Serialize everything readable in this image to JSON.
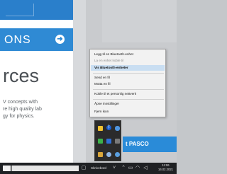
{
  "web_page": {
    "section_title": "ONS",
    "arrow_icon": "arrow-right-icon",
    "heading": "rces",
    "body_lines": [
      "V concepts with",
      "re high quality lab",
      "gy for physics."
    ]
  },
  "context_menu": {
    "items": [
      {
        "label": "Legg til en Bluetooth-enhet",
        "state": "normal"
      },
      {
        "label": "La en enhet koble til",
        "state": "disabled"
      },
      {
        "label": "Vis Bluetooth-enheter",
        "state": "highlighted"
      },
      {
        "label": "Send en fil",
        "state": "normal"
      },
      {
        "label": "Motta en fil",
        "state": "normal"
      },
      {
        "label": "Koble til et personlig nettverk",
        "state": "normal"
      },
      {
        "label": "Åpne innstillinger",
        "state": "normal"
      },
      {
        "label": "Fjern ikon",
        "state": "normal"
      }
    ]
  },
  "tray_popup": {
    "icons": [
      "sticky-note-icon",
      "bluetooth-icon",
      "onedrive-icon",
      "shield-icon",
      "dropbox-icon",
      "speaker-icon",
      "folder-icon",
      "network-icon",
      "globe-icon"
    ]
  },
  "pasco_button": {
    "label": "t PASCO"
  },
  "taskbar": {
    "label": "Skrivebord",
    "clock_time": "11:06",
    "clock_date": "16.02.2021"
  },
  "colors": {
    "accent_blue": "#2a8bd8",
    "highlight": "#c9def2",
    "taskbar": "#1f2124"
  }
}
